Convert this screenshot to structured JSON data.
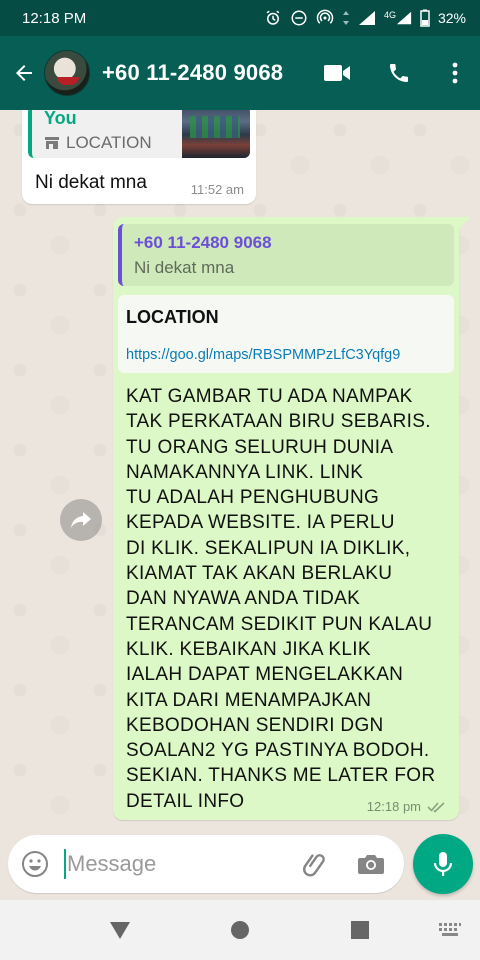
{
  "status_bar": {
    "time": "12:18 PM",
    "network": "4G",
    "battery": "32%"
  },
  "header": {
    "contact": "+60 11-2480 9068",
    "icons": [
      "back-arrow-icon",
      "video-call-icon",
      "voice-call-icon",
      "more-options-icon"
    ]
  },
  "incoming": {
    "quoted_name": "You",
    "quoted_label": "LOCATION",
    "text": "Ni dekat mna",
    "time": "11:52 am"
  },
  "outgoing": {
    "quoted_name": "+60 11-2480 9068",
    "quoted_text": "Ni dekat mna",
    "preview_title": "LOCATION",
    "preview_url": "https://goo.gl/maps/RBSPMMPzLfC3Yqfg9",
    "body": "KAT GAMBAR TU ADA NAMPAK\nTAK PERKATAAN BIRU SEBARIS.\nTU ORANG SELURUH DUNIA\nNAMAKANNYA LINK. LINK\nTU ADALAH PENGHUBUNG\nKEPADA WEBSITE. IA PERLU\nDI KLIK. SEKALIPUN IA DIKLIK,\nKIAMAT TAK AKAN BERLAKU\nDAN NYAWA ANDA TIDAK\nTERANCAM SEDIKIT PUN KALAU\nKLIK. KEBAIKAN JIKA KLIK\nIALAH DAPAT MENGELAKKAN\nKITA DARI MENAMPAJKAN\nKEBODOHAN SENDIRI DGN\nSOALAN2 YG PASTINYA BODOH.\nSEKIAN. THANKS ME LATER FOR\nDETAIL INFO",
    "time": "12:18 pm",
    "status": "double-check-icon"
  },
  "composer": {
    "placeholder": "Message"
  },
  "colors": {
    "header": "#075e54",
    "status_bar": "#054d44",
    "accent": "#00a884",
    "outgoing_bubble": "#dcf8c6",
    "chat_background": "#ece5dd",
    "link": "#0a7cb5"
  }
}
